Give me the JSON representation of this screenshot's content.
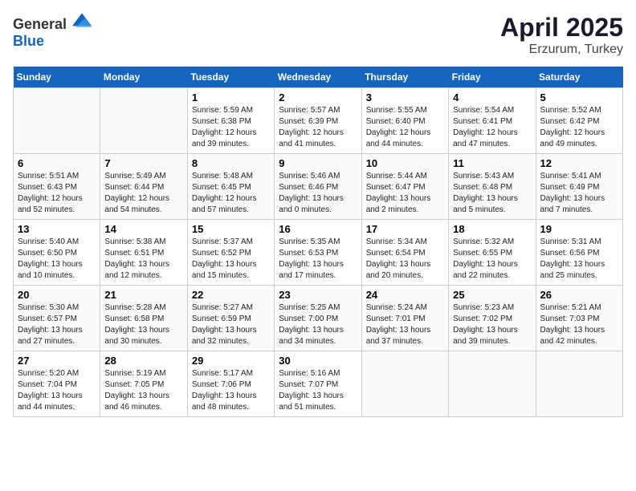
{
  "header": {
    "logo_general": "General",
    "logo_blue": "Blue",
    "title": "April 2025",
    "subtitle": "Erzurum, Turkey"
  },
  "weekdays": [
    "Sunday",
    "Monday",
    "Tuesday",
    "Wednesday",
    "Thursday",
    "Friday",
    "Saturday"
  ],
  "weeks": [
    [
      {
        "day": "",
        "sunrise": "",
        "sunset": "",
        "daylight": ""
      },
      {
        "day": "",
        "sunrise": "",
        "sunset": "",
        "daylight": ""
      },
      {
        "day": "1",
        "sunrise": "Sunrise: 5:59 AM",
        "sunset": "Sunset: 6:38 PM",
        "daylight": "Daylight: 12 hours and 39 minutes."
      },
      {
        "day": "2",
        "sunrise": "Sunrise: 5:57 AM",
        "sunset": "Sunset: 6:39 PM",
        "daylight": "Daylight: 12 hours and 41 minutes."
      },
      {
        "day": "3",
        "sunrise": "Sunrise: 5:55 AM",
        "sunset": "Sunset: 6:40 PM",
        "daylight": "Daylight: 12 hours and 44 minutes."
      },
      {
        "day": "4",
        "sunrise": "Sunrise: 5:54 AM",
        "sunset": "Sunset: 6:41 PM",
        "daylight": "Daylight: 12 hours and 47 minutes."
      },
      {
        "day": "5",
        "sunrise": "Sunrise: 5:52 AM",
        "sunset": "Sunset: 6:42 PM",
        "daylight": "Daylight: 12 hours and 49 minutes."
      }
    ],
    [
      {
        "day": "6",
        "sunrise": "Sunrise: 5:51 AM",
        "sunset": "Sunset: 6:43 PM",
        "daylight": "Daylight: 12 hours and 52 minutes."
      },
      {
        "day": "7",
        "sunrise": "Sunrise: 5:49 AM",
        "sunset": "Sunset: 6:44 PM",
        "daylight": "Daylight: 12 hours and 54 minutes."
      },
      {
        "day": "8",
        "sunrise": "Sunrise: 5:48 AM",
        "sunset": "Sunset: 6:45 PM",
        "daylight": "Daylight: 12 hours and 57 minutes."
      },
      {
        "day": "9",
        "sunrise": "Sunrise: 5:46 AM",
        "sunset": "Sunset: 6:46 PM",
        "daylight": "Daylight: 13 hours and 0 minutes."
      },
      {
        "day": "10",
        "sunrise": "Sunrise: 5:44 AM",
        "sunset": "Sunset: 6:47 PM",
        "daylight": "Daylight: 13 hours and 2 minutes."
      },
      {
        "day": "11",
        "sunrise": "Sunrise: 5:43 AM",
        "sunset": "Sunset: 6:48 PM",
        "daylight": "Daylight: 13 hours and 5 minutes."
      },
      {
        "day": "12",
        "sunrise": "Sunrise: 5:41 AM",
        "sunset": "Sunset: 6:49 PM",
        "daylight": "Daylight: 13 hours and 7 minutes."
      }
    ],
    [
      {
        "day": "13",
        "sunrise": "Sunrise: 5:40 AM",
        "sunset": "Sunset: 6:50 PM",
        "daylight": "Daylight: 13 hours and 10 minutes."
      },
      {
        "day": "14",
        "sunrise": "Sunrise: 5:38 AM",
        "sunset": "Sunset: 6:51 PM",
        "daylight": "Daylight: 13 hours and 12 minutes."
      },
      {
        "day": "15",
        "sunrise": "Sunrise: 5:37 AM",
        "sunset": "Sunset: 6:52 PM",
        "daylight": "Daylight: 13 hours and 15 minutes."
      },
      {
        "day": "16",
        "sunrise": "Sunrise: 5:35 AM",
        "sunset": "Sunset: 6:53 PM",
        "daylight": "Daylight: 13 hours and 17 minutes."
      },
      {
        "day": "17",
        "sunrise": "Sunrise: 5:34 AM",
        "sunset": "Sunset: 6:54 PM",
        "daylight": "Daylight: 13 hours and 20 minutes."
      },
      {
        "day": "18",
        "sunrise": "Sunrise: 5:32 AM",
        "sunset": "Sunset: 6:55 PM",
        "daylight": "Daylight: 13 hours and 22 minutes."
      },
      {
        "day": "19",
        "sunrise": "Sunrise: 5:31 AM",
        "sunset": "Sunset: 6:56 PM",
        "daylight": "Daylight: 13 hours and 25 minutes."
      }
    ],
    [
      {
        "day": "20",
        "sunrise": "Sunrise: 5:30 AM",
        "sunset": "Sunset: 6:57 PM",
        "daylight": "Daylight: 13 hours and 27 minutes."
      },
      {
        "day": "21",
        "sunrise": "Sunrise: 5:28 AM",
        "sunset": "Sunset: 6:58 PM",
        "daylight": "Daylight: 13 hours and 30 minutes."
      },
      {
        "day": "22",
        "sunrise": "Sunrise: 5:27 AM",
        "sunset": "Sunset: 6:59 PM",
        "daylight": "Daylight: 13 hours and 32 minutes."
      },
      {
        "day": "23",
        "sunrise": "Sunrise: 5:25 AM",
        "sunset": "Sunset: 7:00 PM",
        "daylight": "Daylight: 13 hours and 34 minutes."
      },
      {
        "day": "24",
        "sunrise": "Sunrise: 5:24 AM",
        "sunset": "Sunset: 7:01 PM",
        "daylight": "Daylight: 13 hours and 37 minutes."
      },
      {
        "day": "25",
        "sunrise": "Sunrise: 5:23 AM",
        "sunset": "Sunset: 7:02 PM",
        "daylight": "Daylight: 13 hours and 39 minutes."
      },
      {
        "day": "26",
        "sunrise": "Sunrise: 5:21 AM",
        "sunset": "Sunset: 7:03 PM",
        "daylight": "Daylight: 13 hours and 42 minutes."
      }
    ],
    [
      {
        "day": "27",
        "sunrise": "Sunrise: 5:20 AM",
        "sunset": "Sunset: 7:04 PM",
        "daylight": "Daylight: 13 hours and 44 minutes."
      },
      {
        "day": "28",
        "sunrise": "Sunrise: 5:19 AM",
        "sunset": "Sunset: 7:05 PM",
        "daylight": "Daylight: 13 hours and 46 minutes."
      },
      {
        "day": "29",
        "sunrise": "Sunrise: 5:17 AM",
        "sunset": "Sunset: 7:06 PM",
        "daylight": "Daylight: 13 hours and 48 minutes."
      },
      {
        "day": "30",
        "sunrise": "Sunrise: 5:16 AM",
        "sunset": "Sunset: 7:07 PM",
        "daylight": "Daylight: 13 hours and 51 minutes."
      },
      {
        "day": "",
        "sunrise": "",
        "sunset": "",
        "daylight": ""
      },
      {
        "day": "",
        "sunrise": "",
        "sunset": "",
        "daylight": ""
      },
      {
        "day": "",
        "sunrise": "",
        "sunset": "",
        "daylight": ""
      }
    ]
  ]
}
